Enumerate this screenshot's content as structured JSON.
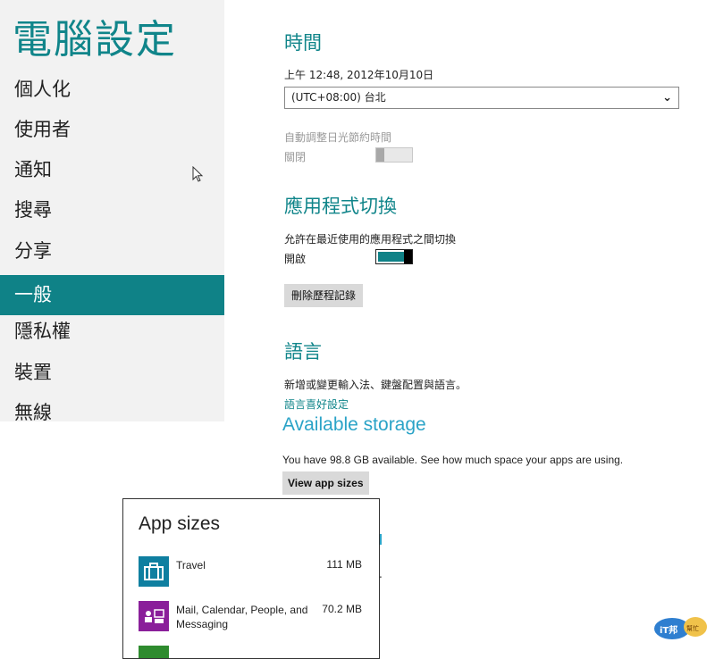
{
  "sidebar": {
    "title": "電腦設定",
    "items": [
      {
        "label": "個人化"
      },
      {
        "label": "使用者"
      },
      {
        "label": "通知"
      },
      {
        "label": "搜尋"
      },
      {
        "label": "分享"
      },
      {
        "label": "一般"
      },
      {
        "label": "隱私權"
      },
      {
        "label": "裝置"
      },
      {
        "label": "無線"
      }
    ]
  },
  "time": {
    "heading": "時間",
    "current": "上午 12:48, 2012年10月10日",
    "timezone": "(UTC+08:00) 台北",
    "dst_label": "自動調整日光節約時間",
    "dst_state": "關閉"
  },
  "app_switch": {
    "heading": "應用程式切換",
    "desc": "允許在最近使用的應用程式之間切換",
    "state": "開啟",
    "clear_button": "刪除歷程記錄"
  },
  "language": {
    "heading": "語言",
    "desc": "新增或變更輸入法、鍵盤配置與語言。",
    "link": "語言喜好設定"
  },
  "storage": {
    "heading": "Available storage",
    "desc": "You have 98.8 GB available. See how much space your apps are using.",
    "button": "View app sizes"
  },
  "app_sizes": {
    "title": "App sizes",
    "apps": [
      {
        "name": "Travel",
        "size": "111 MB",
        "icon": "travel-suitcase-icon",
        "color": "#0f7fa0"
      },
      {
        "name": "Mail, Calendar, People, and Messaging",
        "size": "70.2 MB",
        "icon": "mail-people-icon",
        "color": "#8a1f9a"
      }
    ]
  },
  "watermark": {
    "text": "iT邦幫忙"
  },
  "colors": {
    "accent": "#0f8287",
    "sidebar_bg": "#f2f2f2",
    "storage_blue": "#2aa3c7"
  }
}
